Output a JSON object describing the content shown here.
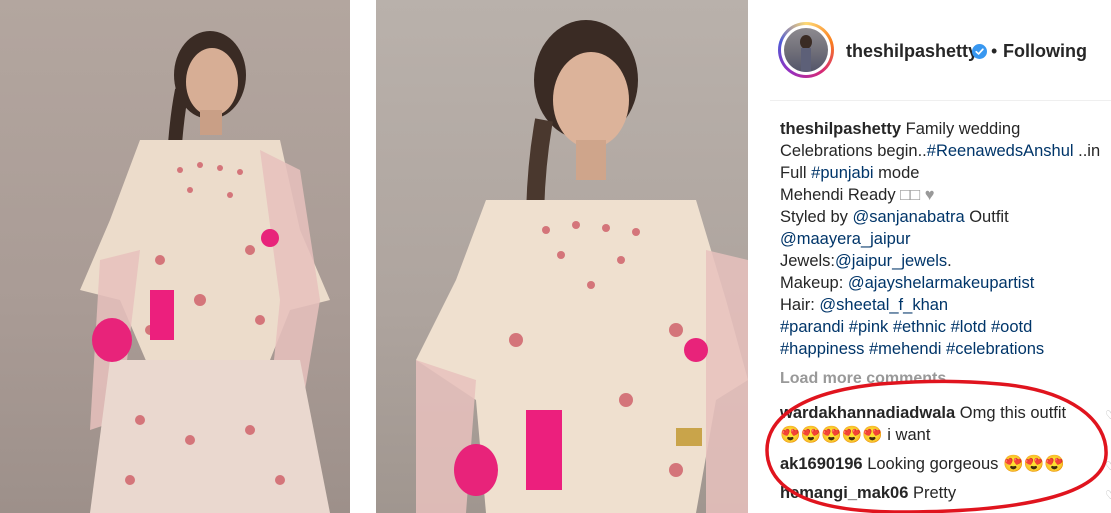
{
  "post": {
    "username": "theshilpashetty",
    "follow_separator": "•",
    "follow_status": "Following",
    "caption_lines": [
      {
        "type": "mixed"
      },
      {
        "text": "Celebrations begin..",
        "tag": "#ReenawedsAnshul",
        "after": " ..in"
      },
      {
        "text": "Full ",
        "tag": "#punjabi",
        "after": " mode"
      },
      {
        "text": "Mehendi Ready ",
        "glyphs": "□□ ♥"
      },
      {
        "text": "Styled by ",
        "tag": "@sanjanabatra",
        "after": " Outfit"
      },
      {
        "text": "",
        "tag": "@maayera_jaipur",
        "after": ""
      },
      {
        "text": "Jewels:",
        "tag": "@jaipur_jewels",
        "after": "."
      },
      {
        "text": "Makeup: ",
        "tag": "@ajayshelarmakeupartist",
        "after": ""
      },
      {
        "text": "Hair: ",
        "tag": "@sheetal_f_khan",
        "after": ""
      },
      {
        "text": "",
        "tag": "#parandi #pink #ethnic #lotd #ootd",
        "after": ""
      },
      {
        "text": "",
        "tag": "#happiness #mehendi #celebrations",
        "after": ""
      }
    ],
    "caption_first": "Family wedding",
    "load_more": "Load more comments",
    "comments": [
      {
        "user": "wardakhannadiadwala",
        "text": "Omg this outfit",
        "text2": "😍😍😍😍😍 i want"
      },
      {
        "user": "ak1690196",
        "text": "Looking gorgeous 😍😍😍"
      },
      {
        "user": "hemangi_mak06",
        "text": "Pretty"
      }
    ]
  },
  "icons": {
    "verified": "verified-badge-icon",
    "heart": "heart-icon"
  },
  "colors": {
    "link": "#003569",
    "annotation": "#e0141e",
    "verified": "#3897f0"
  }
}
